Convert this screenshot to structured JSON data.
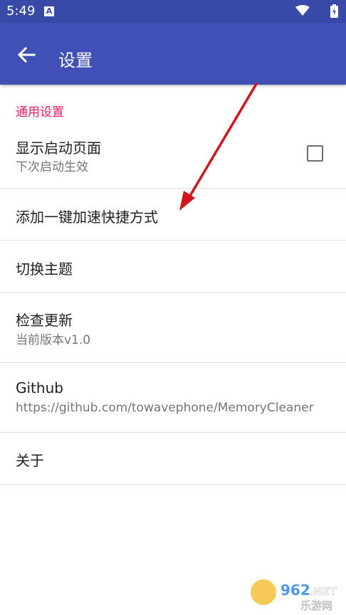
{
  "status_bar": {
    "time": "5:49",
    "notification_icon_letter": "A",
    "icons": [
      "a-notification-icon",
      "wifi-icon",
      "battery-icon"
    ]
  },
  "app_bar": {
    "title": "设置",
    "back_icon": "arrow-left-icon",
    "color": "#3f51b5"
  },
  "settings": {
    "section_header": "通用设置",
    "section_color": "#e91e63",
    "items": [
      {
        "title": "显示启动页面",
        "summary": "下次启动生效",
        "checkbox_checked": false
      },
      {
        "title": "添加一键加速快捷方式"
      },
      {
        "title": "切换主题"
      },
      {
        "title": "检查更新",
        "summary": "当前版本v1.0"
      },
      {
        "title": "Github",
        "summary": "https://github.com/towavephone/MemoryCleaner"
      },
      {
        "title": "关于"
      }
    ]
  },
  "annotation": {
    "arrow_color": "#d3141c",
    "points_to": "添加一键加速快捷方式"
  },
  "watermark": {
    "text_top": "962.NET",
    "text_bottom": "乐游网"
  }
}
